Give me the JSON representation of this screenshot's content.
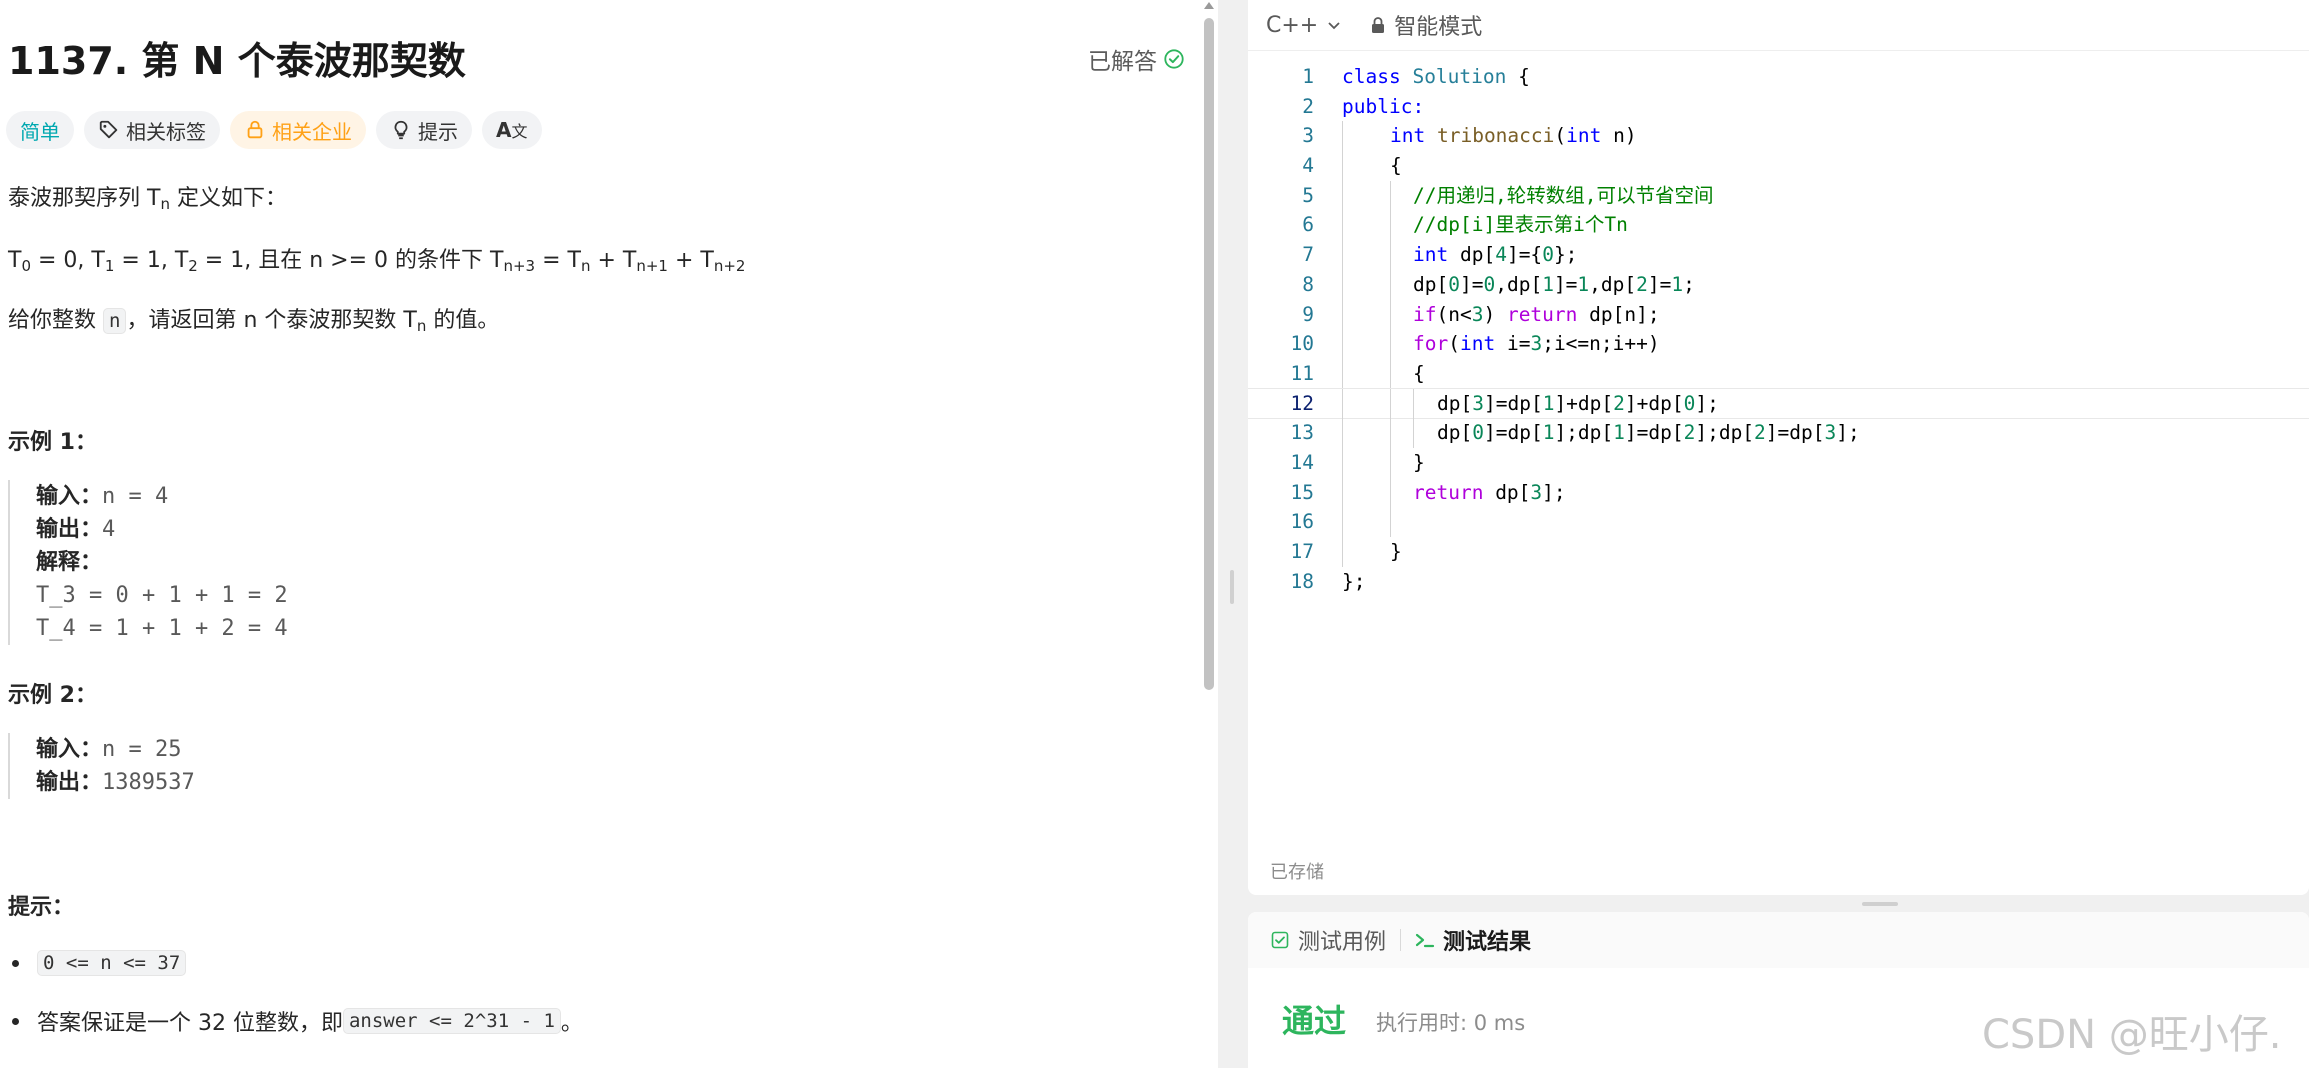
{
  "problem": {
    "title": "1137. 第 N 个泰波那契数",
    "status": "已解答",
    "tags": {
      "difficulty": "简单",
      "related_tags": "相关标签",
      "related_companies": "相关企业",
      "hint": "提示",
      "font": "A"
    },
    "desc_1_a": "泰波那契序列 T",
    "desc_1_sub": "n",
    "desc_1_b": " 定义如下：",
    "formula": {
      "t": "T",
      "s0": "0",
      "v0": " = 0, ",
      "s1": "1",
      "v1": " = 1, ",
      "s2": "2",
      "v2": " = 1, 且在 n >= 0 的条件下 ",
      "sa": "n+3",
      "eq": " = ",
      "sb": "n",
      "plus1": " + ",
      "sc": "n+1",
      "plus2": " + ",
      "sd": "n+2"
    },
    "desc_2_a": "给你整数 ",
    "desc_2_code": "n",
    "desc_2_b": "，请返回第 n 个泰波那契数 T",
    "desc_2_sub": "n",
    "desc_2_c": " 的值。",
    "example1": {
      "heading": "示例 1：",
      "input_label": "输入：",
      "input_value": "n = 4",
      "output_label": "输出：",
      "output_value": "4",
      "explain_label": "解释：",
      "explain_line1": "T_3 = 0 + 1 + 1 = 2",
      "explain_line2": "T_4 = 1 + 1 + 2 = 4"
    },
    "example2": {
      "heading": "示例 2：",
      "input_label": "输入：",
      "input_value": "n = 25",
      "output_label": "输出：",
      "output_value": "1389537"
    },
    "constraints": {
      "heading": "提示：",
      "item1_code": "0 <= n <= 37",
      "item2_a": "答案保证是一个 32 位整数，即 ",
      "item2_code": "answer <= 2^31 - 1",
      "item2_b": "。"
    }
  },
  "editor": {
    "language": "C++",
    "mode": "智能模式",
    "saved": "已存储",
    "line_numbers": [
      "1",
      "2",
      "3",
      "4",
      "5",
      "6",
      "7",
      "8",
      "9",
      "10",
      "11",
      "12",
      "13",
      "14",
      "15",
      "16",
      "17",
      "18"
    ],
    "code": {
      "l1_kw": "class",
      "l1_cls": "Solution",
      "l1_rest": " {",
      "l2_kw": "public:",
      "l3_kw": "int",
      "l3_fn": "tribonacci",
      "l3_p1": "(",
      "l3_kw2": "int",
      "l3_rest": " n)",
      "l4": "{",
      "l5": "//用递归,轮转数组,可以节省空间",
      "l6": "//dp[i]里表示第i个Tn",
      "l7_kw": "int",
      "l7_a": " dp[",
      "l7_n1": "4",
      "l7_b": "]={",
      "l7_n2": "0",
      "l7_c": "};",
      "l8_a": "dp[",
      "l8_n1": "0",
      "l8_b": "]=",
      "l8_n2": "0",
      "l8_c": ",dp[",
      "l8_n3": "1",
      "l8_d": "]=",
      "l8_n4": "1",
      "l8_e": ",dp[",
      "l8_n5": "2",
      "l8_f": "]=",
      "l8_n6": "1",
      "l8_g": ";",
      "l9_kw": "if",
      "l9_a": "(n<",
      "l9_n": "3",
      "l9_b": ") ",
      "l9_kw2": "return",
      "l9_c": " dp[n];",
      "l10_kw": "for",
      "l10_a": "(",
      "l10_kw2": "int",
      "l10_b": " i=",
      "l10_n": "3",
      "l10_c": ";i<=n;i++)",
      "l11": "{",
      "l12_a": "dp[",
      "l12_n1": "3",
      "l12_b": "]=dp[",
      "l12_n2": "1",
      "l12_c": "]+dp[",
      "l12_n3": "2",
      "l12_d": "]+dp[",
      "l12_n4": "0",
      "l12_e": "];",
      "l13_a": "dp[",
      "l13_n1": "0",
      "l13_b": "]=dp[",
      "l13_n2": "1",
      "l13_c": "];dp[",
      "l13_n3": "1",
      "l13_d": "]=dp[",
      "l13_n4": "2",
      "l13_e": "];dp[",
      "l13_n5": "2",
      "l13_f": "]=dp[",
      "l13_n6": "3",
      "l13_g": "];",
      "l14": "}",
      "l15_kw": "return",
      "l15_a": " dp[",
      "l15_n": "3",
      "l15_b": "];",
      "l17": "}",
      "l18": "};"
    }
  },
  "result": {
    "tab_testcase": "测试用例",
    "tab_result": "测试结果",
    "verdict": "通过",
    "runtime": "执行用时: 0 ms"
  },
  "watermark": "CSDN @旺小仔.",
  "colors": {
    "easy": "#00a8b0",
    "company": "#ffa116",
    "pass": "#2db55d",
    "keyword": "#0000ff",
    "comment": "#008000"
  }
}
